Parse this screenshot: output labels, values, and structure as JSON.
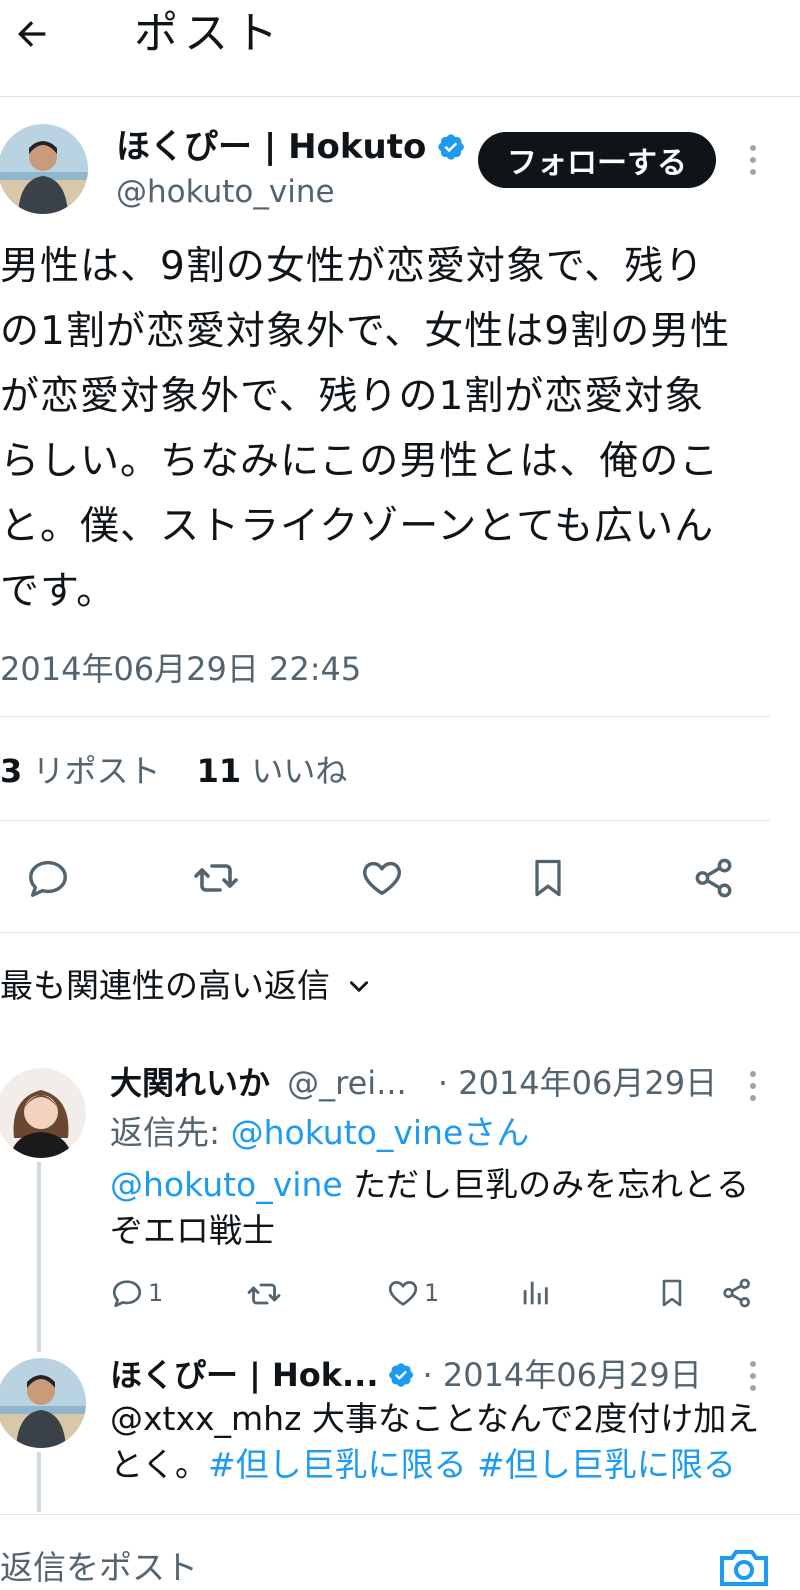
{
  "header": {
    "title": "ポスト"
  },
  "post": {
    "author_name": "ほくぴー | Hokuto",
    "handle": "@hokuto_vine",
    "follow_label": "フォローする",
    "body": "男性は、9割の女性が恋愛対象で、残り\nの1割が恋愛対象外で、女性は9割の男性\nが恋愛対象外で、残りの1割が恋愛対象\nらしい。ちなみにこの男性とは、俺のこ\nと。僕、ストライクゾーンとても広いん\nです。",
    "timestamp": "2014年06月29日 22:45",
    "reposts_count": "3",
    "reposts_label": "リポスト",
    "likes_count": "11",
    "likes_label": "いいね"
  },
  "replies_sort": {
    "label": "最も関連性の高い返信"
  },
  "replies": [
    {
      "name": "大関れいか",
      "handle": "@_rei...",
      "date": "· 2014年06月29日",
      "reply_to_prefix": "返信先: ",
      "reply_to_handle": "@hokuto_vineさん",
      "mention": "@hokuto_vine",
      "text": " ただし巨乳のみを忘れとる\nぞエロ戦士",
      "reply_count": "1",
      "like_count": "1"
    },
    {
      "name": "ほくぴー | Hok...",
      "date": "· 2014年06月29日",
      "text_line1": "@xtxx_mhz 大事なことなんで2度付け加え",
      "text_line2_prefix": "とく。",
      "hashtag1": "#但し巨乳に限る",
      "hashtag2": "#但し巨乳に限る"
    }
  ],
  "composer": {
    "placeholder": "返信をポスト"
  },
  "colors": {
    "accent": "#1d9bf0",
    "text": "#0f1419",
    "secondary": "#536471",
    "border": "#dfe3e7"
  }
}
